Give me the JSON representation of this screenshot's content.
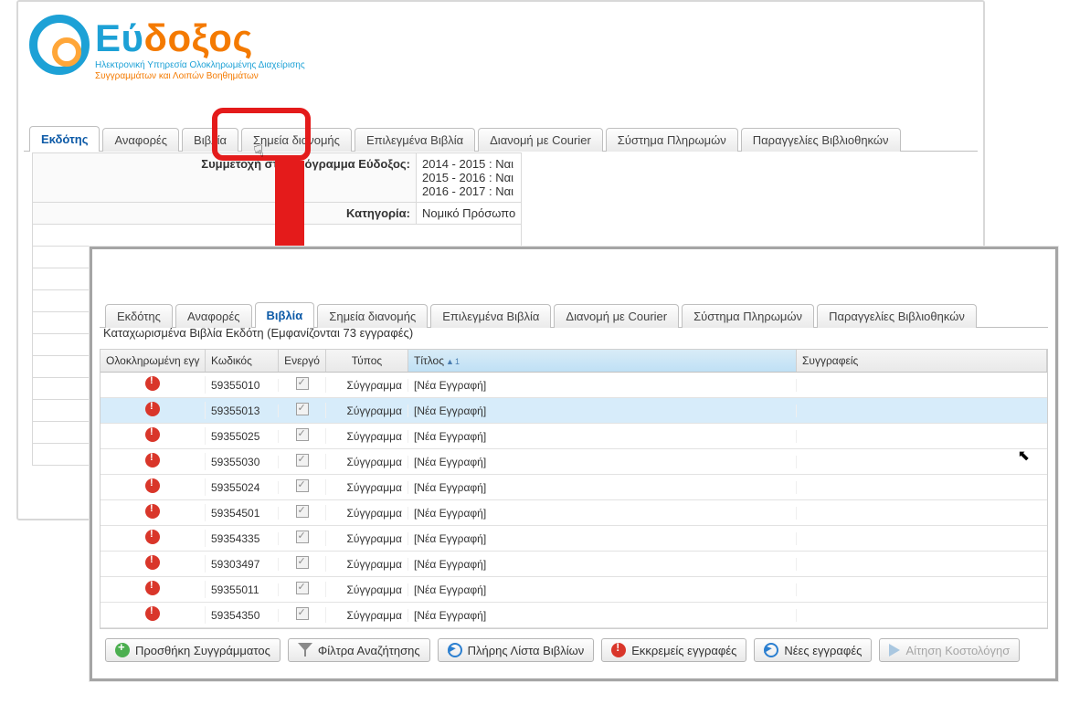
{
  "logo": {
    "name": "Εύδοξος",
    "tag1": "Ηλεκτρονική Υπηρεσία Ολοκληρωμένης Διαχείρισης",
    "tag2": "Συγγραμμάτων και Λοιπών Βοηθημάτων"
  },
  "tabs": [
    "Εκδότης",
    "Αναφορές",
    "Βιβλία",
    "Σημεία διανομής",
    "Επιλεγμένα Βιβλία",
    "Διανομή με Courier",
    "Σύστημα Πληρωμών",
    "Παραγγελίες Βιβλιοθηκών"
  ],
  "panel1": {
    "active_tab": "Εκδότης",
    "info": {
      "participation_label": "Συμμετοχή στο πρόγραμμα Εύδοξος:",
      "participation_values": [
        "2014 - 2015 : Ναι",
        "2015 - 2016 : Ναι",
        "2016 - 2017 : Ναι"
      ],
      "category_label": "Κατηγορία:",
      "category_value": "Νομικό Πρόσωπο"
    }
  },
  "panel2": {
    "active_tab": "Βιβλία",
    "records_text": "Καταχωρισμένα Βιβλία Εκδότη (Εμφανίζονται 73 εγγραφές)",
    "columns": {
      "complete": "Ολοκληρωμένη εγγ",
      "code": "Κωδικός",
      "active": "Ενεργό",
      "type": "Τύπος",
      "title": "Τίτλος",
      "authors": "Συγγραφείς"
    },
    "rows": [
      {
        "code": "59355010",
        "type": "Σύγγραμμα",
        "title": "[Νέα Εγγραφή]"
      },
      {
        "code": "59355013",
        "type": "Σύγγραμμα",
        "title": "[Νέα Εγγραφή]"
      },
      {
        "code": "59355025",
        "type": "Σύγγραμμα",
        "title": "[Νέα Εγγραφή]"
      },
      {
        "code": "59355030",
        "type": "Σύγγραμμα",
        "title": "[Νέα Εγγραφή]"
      },
      {
        "code": "59355024",
        "type": "Σύγγραμμα",
        "title": "[Νέα Εγγραφή]"
      },
      {
        "code": "59354501",
        "type": "Σύγγραμμα",
        "title": "[Νέα Εγγραφή]"
      },
      {
        "code": "59354335",
        "type": "Σύγγραμμα",
        "title": "[Νέα Εγγραφή]"
      },
      {
        "code": "59303497",
        "type": "Σύγγραμμα",
        "title": "[Νέα Εγγραφή]"
      },
      {
        "code": "59355011",
        "type": "Σύγγραμμα",
        "title": "[Νέα Εγγραφή]"
      },
      {
        "code": "59354350",
        "type": "Σύγγραμμα",
        "title": "[Νέα Εγγραφή]"
      }
    ],
    "toolbar": {
      "add": "Προσθήκη Συγγράμματος",
      "filters": "Φίλτρα Αναζήτησης",
      "full_list": "Πλήρης Λίστα Βιβλίων",
      "pending": "Εκκρεμείς εγγραφές",
      "new": "Νέες εγγραφές",
      "pricing": "Αίτηση Κοστολόγησ"
    }
  }
}
